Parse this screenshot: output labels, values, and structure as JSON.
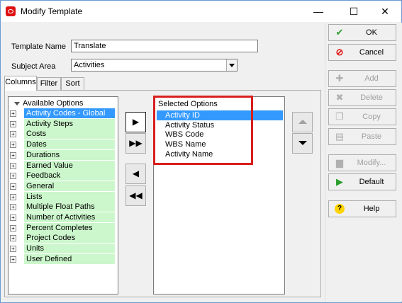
{
  "window": {
    "title": "Modify Template",
    "controls": {
      "minimize": "—",
      "maximize": "☐",
      "close": "✕"
    }
  },
  "form": {
    "template_name_label": "Template Name",
    "template_name_value": "Translate",
    "subject_area_label": "Subject Area",
    "subject_area_value": "Activities"
  },
  "tabs": [
    {
      "label": "Columns",
      "active": true
    },
    {
      "label": "Filter",
      "active": false
    },
    {
      "label": "Sort",
      "active": false
    }
  ],
  "available": {
    "header": "Available Options",
    "items": [
      {
        "label": "Activity Codes - Global",
        "selected": true
      },
      {
        "label": "Activity Steps"
      },
      {
        "label": "Costs"
      },
      {
        "label": "Dates"
      },
      {
        "label": "Durations"
      },
      {
        "label": "Earned Value"
      },
      {
        "label": "Feedback"
      },
      {
        "label": "General"
      },
      {
        "label": "Lists"
      },
      {
        "label": "Multiple Float Paths"
      },
      {
        "label": "Number of Activities"
      },
      {
        "label": "Percent Completes"
      },
      {
        "label": "Project Codes"
      },
      {
        "label": "Units"
      },
      {
        "label": "User Defined"
      }
    ]
  },
  "selected": {
    "header": "Selected Options",
    "items": [
      {
        "label": "Activity ID",
        "selected": true
      },
      {
        "label": "Activity Status"
      },
      {
        "label": "WBS Code"
      },
      {
        "label": "WBS Name"
      },
      {
        "label": "Activity Name"
      }
    ]
  },
  "move_buttons": {
    "add": "▶",
    "add_all": "▶▶",
    "remove": "◀",
    "remove_all": "◀◀"
  },
  "right_buttons": {
    "ok": "OK",
    "cancel": "Cancel",
    "add": "Add",
    "delete": "Delete",
    "copy": "Copy",
    "paste": "Paste",
    "modify": "Modify...",
    "default": "Default",
    "help": "Help"
  },
  "colors": {
    "highlight_box": "#d81e1e",
    "available_bg": "#ccf7cc",
    "selection": "#3399ff"
  }
}
